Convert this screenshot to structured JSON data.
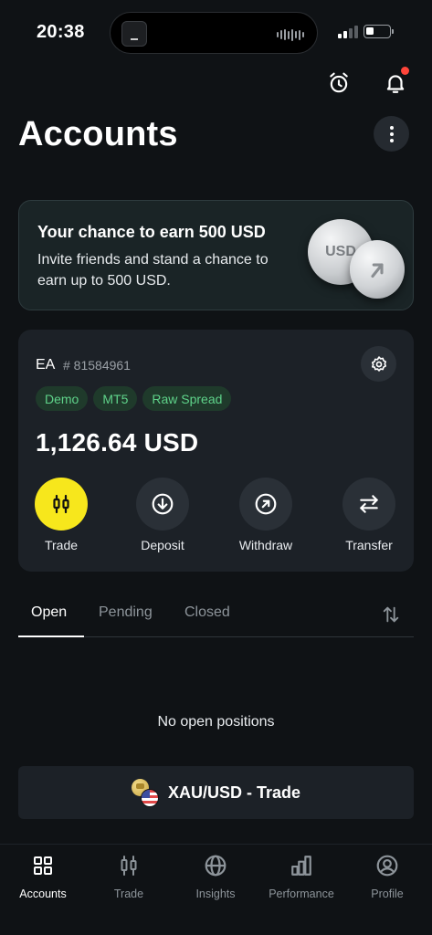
{
  "status_bar": {
    "time": "20:38"
  },
  "header": {
    "title": "Accounts"
  },
  "promo": {
    "title": "Your chance to earn 500 USD",
    "text": "Invite friends and stand a chance to earn up to 500 USD.",
    "coin_text": "USD"
  },
  "account": {
    "name": "EA",
    "number": "# 81584961",
    "badges": [
      "Demo",
      "MT5",
      "Raw Spread"
    ],
    "balance": "1,126.64 USD",
    "actions": [
      {
        "label": "Trade",
        "icon": "candlestick-icon"
      },
      {
        "label": "Deposit",
        "icon": "arrow-down-circle-icon"
      },
      {
        "label": "Withdraw",
        "icon": "arrow-up-right-circle-icon"
      },
      {
        "label": "Transfer",
        "icon": "transfer-arrows-icon"
      }
    ]
  },
  "tabs": {
    "items": [
      "Open",
      "Pending",
      "Closed"
    ],
    "active": "Open"
  },
  "positions": {
    "empty_text": "No open positions"
  },
  "trade_button": {
    "label": "XAU/USD - Trade"
  },
  "bottom_nav": {
    "items": [
      {
        "label": "Accounts",
        "icon": "grid-icon"
      },
      {
        "label": "Trade",
        "icon": "candlestick-icon"
      },
      {
        "label": "Insights",
        "icon": "globe-icon"
      },
      {
        "label": "Performance",
        "icon": "bar-chart-icon"
      },
      {
        "label": "Profile",
        "icon": "user-circle-icon"
      }
    ],
    "active": "Accounts"
  },
  "colors": {
    "background": "#0f1215",
    "card": "#1c2127",
    "accent_yellow": "#f7e71c",
    "badge_green": "#5fd38a",
    "notification_red": "#ff453a"
  }
}
